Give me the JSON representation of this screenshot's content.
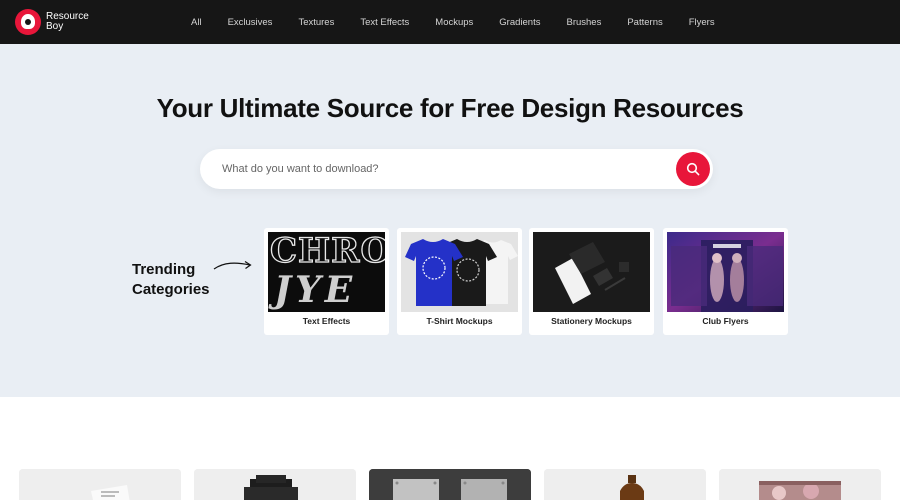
{
  "logo": {
    "line1": "Resource",
    "line2": "Boy"
  },
  "nav": [
    "All",
    "Exclusives",
    "Textures",
    "Text Effects",
    "Mockups",
    "Gradients",
    "Brushes",
    "Patterns",
    "Flyers"
  ],
  "hero": {
    "title": "Your Ultimate Source for Free Design Resources",
    "search_placeholder": "What do you want to download?"
  },
  "trending": {
    "line1": "Trending",
    "line2": "Categories"
  },
  "categories": [
    {
      "label": "Text Effects",
      "thumb_text_1": "CHRO",
      "thumb_text_2": "JYE"
    },
    {
      "label": "T-Shirt Mockups"
    },
    {
      "label": "Stationery Mockups"
    },
    {
      "label": "Club Flyers"
    }
  ],
  "colors": {
    "accent": "#e8163a",
    "topbar": "#161616",
    "hero_bg": "#e9eef4"
  }
}
